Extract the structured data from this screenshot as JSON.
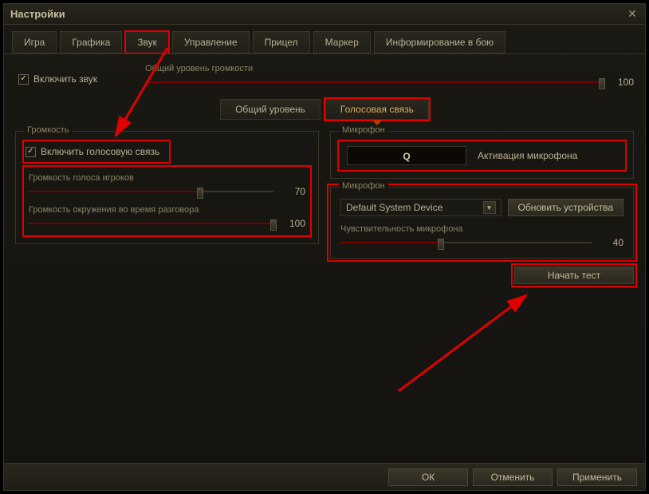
{
  "window": {
    "title": "Настройки"
  },
  "tabs": [
    {
      "label": "Игра"
    },
    {
      "label": "Графика"
    },
    {
      "label": "Звук"
    },
    {
      "label": "Управление"
    },
    {
      "label": "Прицел"
    },
    {
      "label": "Маркер"
    },
    {
      "label": "Информирование в бою"
    }
  ],
  "enable_sound": {
    "label": "Включить звук",
    "checked": true
  },
  "master_volume": {
    "label": "Общий уровень громкости",
    "value": 100
  },
  "subtabs": {
    "general": "Общий уровень",
    "voice": "Голосовая связь"
  },
  "volume_group": {
    "legend": "Громкость",
    "enable_voice": {
      "label": "Включить голосовую связь",
      "checked": true
    },
    "players_voice": {
      "label": "Громкость голоса игроков",
      "value": 70
    },
    "ambient_talk": {
      "label": "Громкость окружения во время разговора",
      "value": 100
    }
  },
  "mic_group": {
    "legend": "Микрофон",
    "key": "Q",
    "activate_label": "Активация микрофона",
    "device_legend": "Микрофон",
    "device_selected": "Default System Device",
    "refresh_label": "Обновить устройства",
    "sensitivity": {
      "label": "Чувствительность микрофона",
      "value": 40
    },
    "test_label": "Начать тест"
  },
  "footer": {
    "ok": "ОК",
    "cancel": "Отменить",
    "apply": "Применить"
  }
}
